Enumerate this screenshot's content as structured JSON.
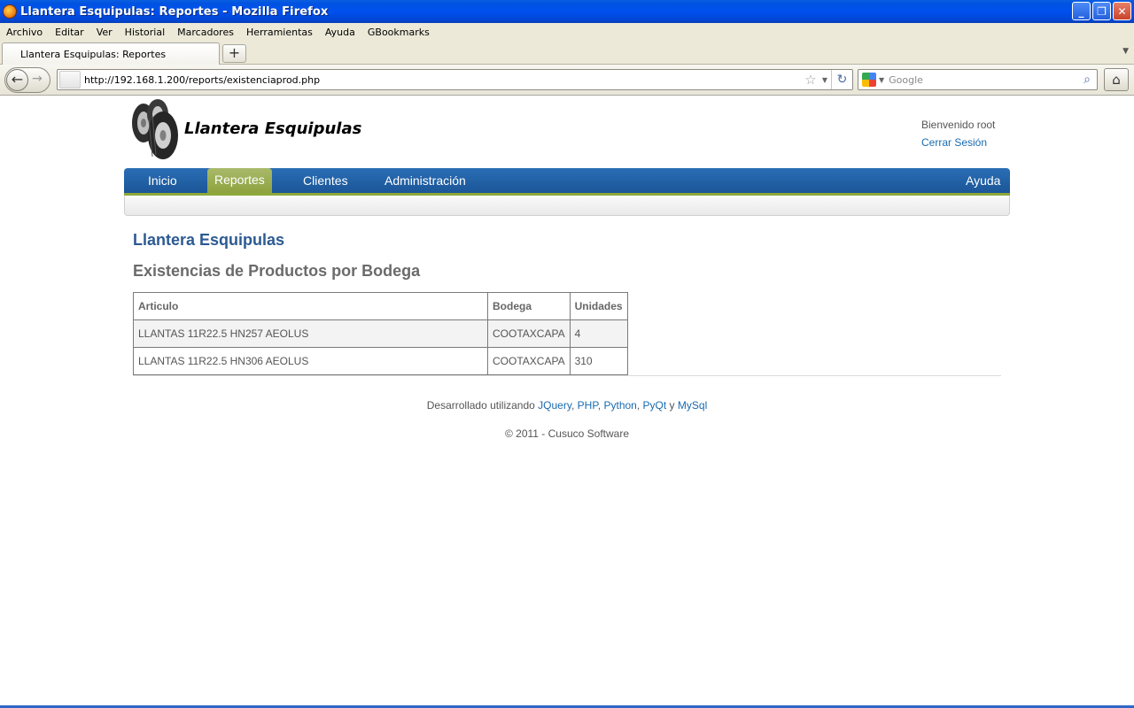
{
  "window": {
    "title": "Llantera Esquipulas: Reportes - Mozilla Firefox",
    "minimize": "_",
    "maximize": "❐",
    "close": "✕"
  },
  "menu": [
    "Archivo",
    "Editar",
    "Ver",
    "Historial",
    "Marcadores",
    "Herramientas",
    "Ayuda",
    "GBookmarks"
  ],
  "tabs": {
    "active_label": "Llantera Esquipulas: Reportes",
    "new_tab": "+"
  },
  "nav": {
    "url": "http://192.168.1.200/reports/existenciaprod.php",
    "search_placeholder": "Google"
  },
  "site": {
    "title": "Llantera Esquipulas",
    "welcome": "Bienvenido root",
    "logout": "Cerrar Sesión",
    "menu": {
      "home": "Inicio",
      "reports": "Reportes",
      "clients": "Clientes",
      "admin": "Administración",
      "help": "Ayuda"
    }
  },
  "report": {
    "company": "Llantera Esquipulas",
    "heading": "Existencias de Productos por Bodega",
    "columns": [
      "Articulo",
      "Bodega",
      "Unidades"
    ],
    "rows": [
      [
        "LLANTAS 11R22.5 HN257 AEOLUS",
        "COOTAXCAPA",
        "4"
      ],
      [
        "LLANTAS 11R22.5 HN306 AEOLUS",
        "COOTAXCAPA",
        "310"
      ]
    ]
  },
  "footer": {
    "prefix": "Desarrollado utilizando",
    "tech": [
      "JQuery",
      "PHP",
      "Python",
      "PyQt",
      "MySql"
    ],
    "separator": ",",
    "conjunction": "y",
    "copyright": "© 2011 - Cusuco Software"
  }
}
